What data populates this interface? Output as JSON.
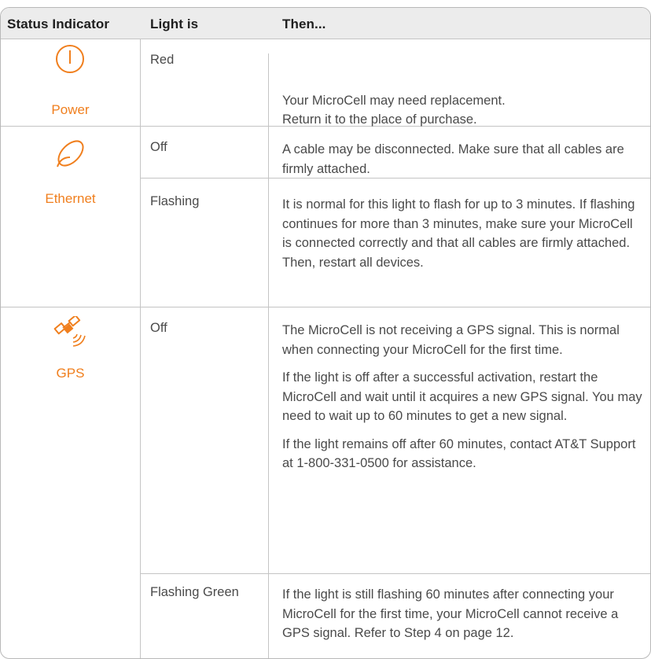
{
  "header": {
    "status_indicator": "Status Indicator",
    "light_is": "Light is",
    "then": "Then..."
  },
  "accent_color": "#f07f1e",
  "rows": [
    {
      "indicator": "Power",
      "icon": "power-icon",
      "states": [
        {
          "light": "Red",
          "then": [
            "Your MicroCell may need replacement.\nReturn it to the place of purchase."
          ]
        }
      ]
    },
    {
      "indicator": "Ethernet",
      "icon": "ethernet-icon",
      "states": [
        {
          "light": "Off",
          "then": [
            "A cable may be disconnected. Make sure that all cables are firmly attached."
          ]
        },
        {
          "light": "Flashing",
          "then": [
            "It is normal for this light to flash for up to 3 minutes. If flashing continues for more than 3 minutes, make sure your MicroCell is connected correctly and that all cables are firmly attached. Then, restart all devices."
          ]
        }
      ]
    },
    {
      "indicator": "GPS",
      "icon": "satellite-icon",
      "states": [
        {
          "light": "Off",
          "then": [
            "The MicroCell is not receiving a GPS signal. This is normal when connecting your MicroCell for the first time.",
            "If the light is off after a successful activation, restart the MicroCell and wait until it acquires a new GPS signal. You may need to wait up to 60 minutes to get a new signal.",
            "If the light remains off after 60 minutes, contact AT&T Support at 1-800-331-0500 for assistance."
          ]
        },
        {
          "light": "Flashing Green",
          "then": [
            "If the light is still flashing 60 minutes after connecting your MicroCell for the first time, your MicroCell cannot receive a GPS signal. Refer to Step 4 on page 12."
          ]
        }
      ]
    }
  ]
}
